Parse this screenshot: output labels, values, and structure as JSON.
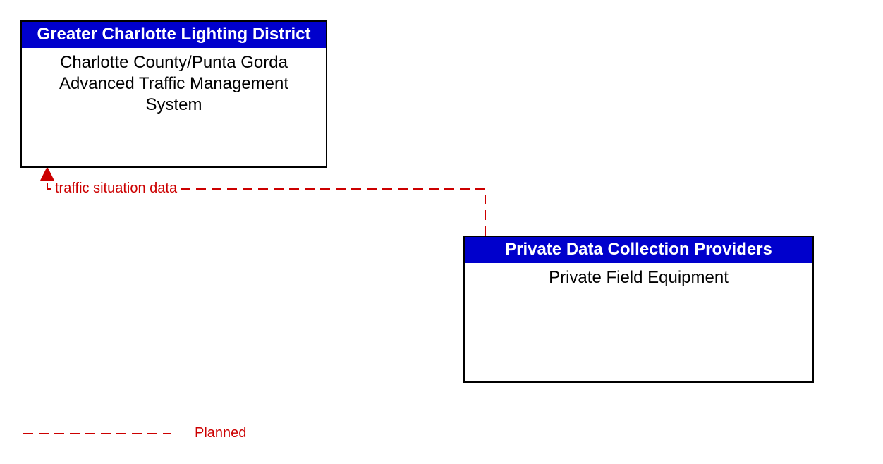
{
  "boxes": {
    "left": {
      "header": "Greater Charlotte Lighting District",
      "body_line1": "Charlotte County/Punta Gorda",
      "body_line2": "Advanced Traffic Management System"
    },
    "right": {
      "header": "Private Data Collection Providers",
      "body_line1": "Private Field Equipment"
    }
  },
  "flows": {
    "traffic_situation": "traffic situation data"
  },
  "legend": {
    "planned": "Planned"
  },
  "colors": {
    "header_bg": "#0000cc",
    "flow": "#cc0000"
  }
}
